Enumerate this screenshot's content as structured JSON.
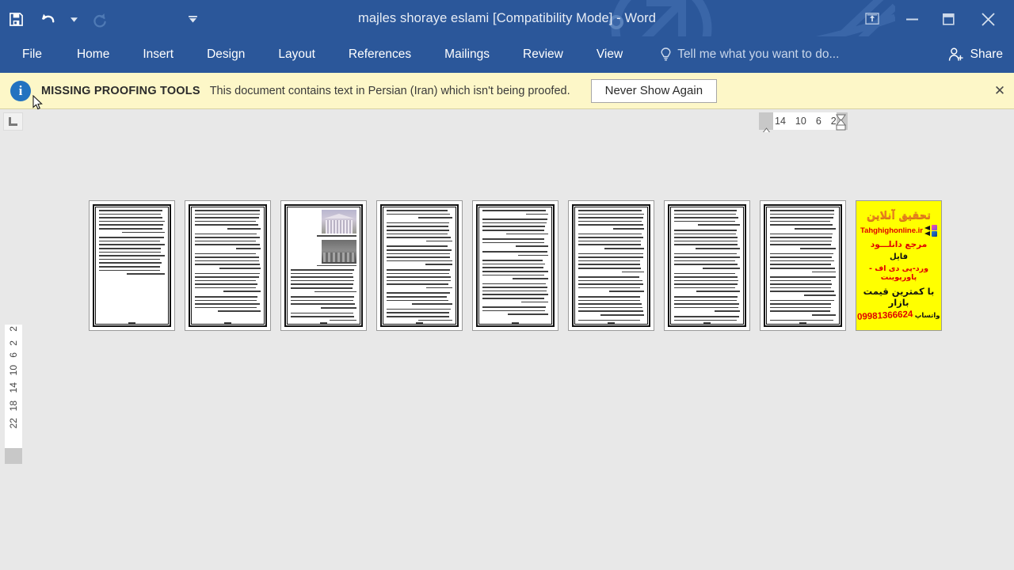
{
  "window": {
    "title": "majles shoraye eslami [Compatibility Mode] - Word",
    "accent_color": "#2b579a",
    "quick_access": [
      {
        "name": "save",
        "label": "Save"
      },
      {
        "name": "undo",
        "label": "Undo"
      },
      {
        "name": "undo-dropdown",
        "label": "Undo options"
      },
      {
        "name": "redo",
        "label": "Repeat"
      },
      {
        "name": "customize-qat",
        "label": "Customize Quick Access Toolbar"
      }
    ],
    "controls": [
      {
        "name": "ribbon-display-options",
        "label": "Ribbon Display Options"
      },
      {
        "name": "minimize",
        "label": "Minimize"
      },
      {
        "name": "restore",
        "label": "Restore Down"
      },
      {
        "name": "close",
        "label": "Close"
      }
    ]
  },
  "ribbon": {
    "tabs": [
      {
        "label": "File",
        "active": false
      },
      {
        "label": "Home",
        "active": false
      },
      {
        "label": "Insert",
        "active": false
      },
      {
        "label": "Design",
        "active": false
      },
      {
        "label": "Layout",
        "active": false
      },
      {
        "label": "References",
        "active": false
      },
      {
        "label": "Mailings",
        "active": false
      },
      {
        "label": "Review",
        "active": false
      },
      {
        "label": "View",
        "active": false
      }
    ],
    "tell_me": "Tell me what you want to do...",
    "share_label": "Share"
  },
  "message_bar": {
    "icon": "info-icon",
    "heading": "MISSING PROOFING TOOLS",
    "text": "This document contains text in Persian (Iran) which isn't being proofed.",
    "button_label": "Never Show Again",
    "close_label": "✕",
    "background_color": "#fdf7c8"
  },
  "ruler": {
    "tab_selector": "left-tab-stop",
    "horizontal_marks": [
      "14",
      "10",
      "6",
      "2"
    ],
    "vertical_marks_top": [
      "2"
    ],
    "vertical_marks": [
      "2",
      "6",
      "10",
      "14",
      "18",
      "22"
    ]
  },
  "document": {
    "background_color": "#e8e8e8",
    "zoom_view": "multiple-pages",
    "pages": [
      {
        "index": 1,
        "type": "text",
        "paragraphs": [
          7,
          11
        ],
        "has_page_number": true
      },
      {
        "index": 2,
        "type": "text",
        "paragraphs": [
          6,
          5,
          5,
          6,
          5
        ],
        "has_page_number": true
      },
      {
        "index": 3,
        "type": "images",
        "photos": [
          "classical-building-photo",
          "dark-building-photo"
        ],
        "paragraphs": [
          7,
          4,
          3
        ],
        "has_page_number": true
      },
      {
        "index": 4,
        "type": "text",
        "paragraphs": [
          3,
          6,
          6,
          6,
          4,
          4,
          4
        ],
        "has_page_number": true
      },
      {
        "index": 5,
        "type": "text",
        "paragraphs": [
          2,
          5,
          3,
          2,
          6,
          6,
          3
        ],
        "has_page_number": true
      },
      {
        "index": 6,
        "type": "text",
        "paragraphs": [
          6,
          5,
          6,
          5,
          6,
          4
        ],
        "has_page_number": true
      },
      {
        "index": 7,
        "type": "text",
        "paragraphs": [
          5,
          6,
          5,
          6,
          5,
          5
        ],
        "has_page_number": true
      },
      {
        "index": 8,
        "type": "text",
        "paragraphs": [
          6,
          5,
          6,
          6,
          5,
          4
        ],
        "has_page_number": true
      },
      {
        "index": 9,
        "type": "advertisement",
        "has_page_number": false
      }
    ]
  },
  "advertisement": {
    "title": "تحقیق آنلاین",
    "url": "Tahghighonline.ir",
    "line_download": "مرجع دانلـــود",
    "line_file": "فایل",
    "line_formats": "ورد-پی دی اف - پاورپوینت",
    "line_price": "با کمترین قیمت بازار",
    "phone": "09981366624",
    "whatsapp_label": "واتساپ",
    "background_color": "#ffff00",
    "title_color": "#e8821e",
    "accent_red": "#e00000"
  }
}
